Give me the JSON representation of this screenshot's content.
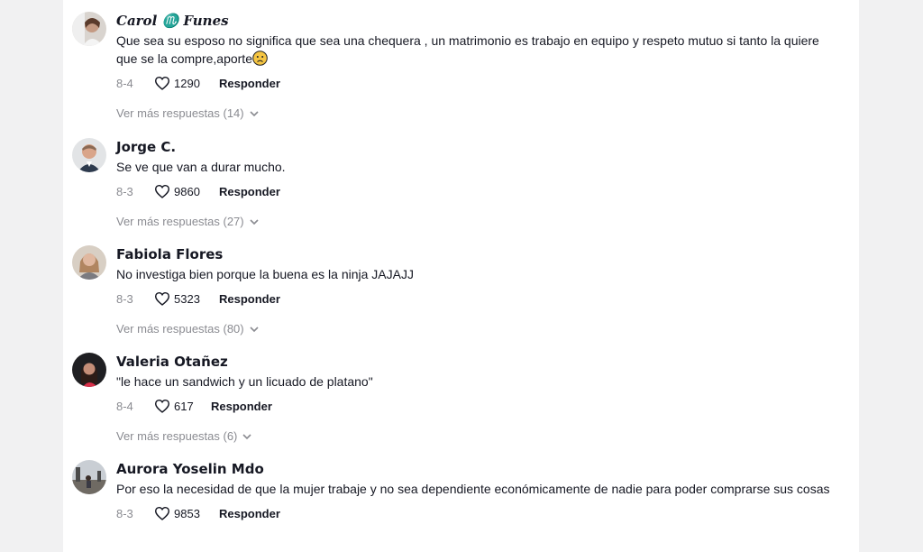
{
  "comments": [
    {
      "author": "Carol ♏ Funes",
      "text": "Que sea su esposo no significa que sea una chequera , un matrimonio es trabajo en equipo y respeto mutuo si tanto la quiere que se la compre,aporte",
      "date": "8-4",
      "likes": "1290",
      "reply_label": "Responder",
      "more_replies": "Ver más respuestas (14)"
    },
    {
      "author": "Jorge C.",
      "text": "Se ve que van a durar mucho.",
      "date": "8-3",
      "likes": "9860",
      "reply_label": "Responder",
      "more_replies": "Ver más respuestas (27)"
    },
    {
      "author": "Fabiola Flores",
      "text": "No investiga bien porque la buena es la ninja JAJAJJ",
      "date": "8-3",
      "likes": "5323",
      "reply_label": "Responder",
      "more_replies": "Ver más respuestas (80)"
    },
    {
      "author": "Valeria Otañez",
      "text": "\"le hace un sandwich y un licuado de platano\"",
      "date": "8-4",
      "likes": "617",
      "reply_label": "Responder",
      "more_replies": "Ver más respuestas (6)"
    },
    {
      "author": "Aurora Yoselin Mdo",
      "text": "Por eso la necesidad de que la mujer trabaje y no sea dependiente económicamente de nadie para poder comprarse sus cosas",
      "date": "8-3",
      "likes": "9853",
      "reply_label": "Responder"
    }
  ],
  "icons": {
    "like": "heart-outline-icon",
    "expand": "chevron-down-icon",
    "emoji": "frowning-face-emoji"
  },
  "colors": {
    "text": "#161823",
    "muted": "#8a8b91",
    "background": "#ffffff"
  }
}
